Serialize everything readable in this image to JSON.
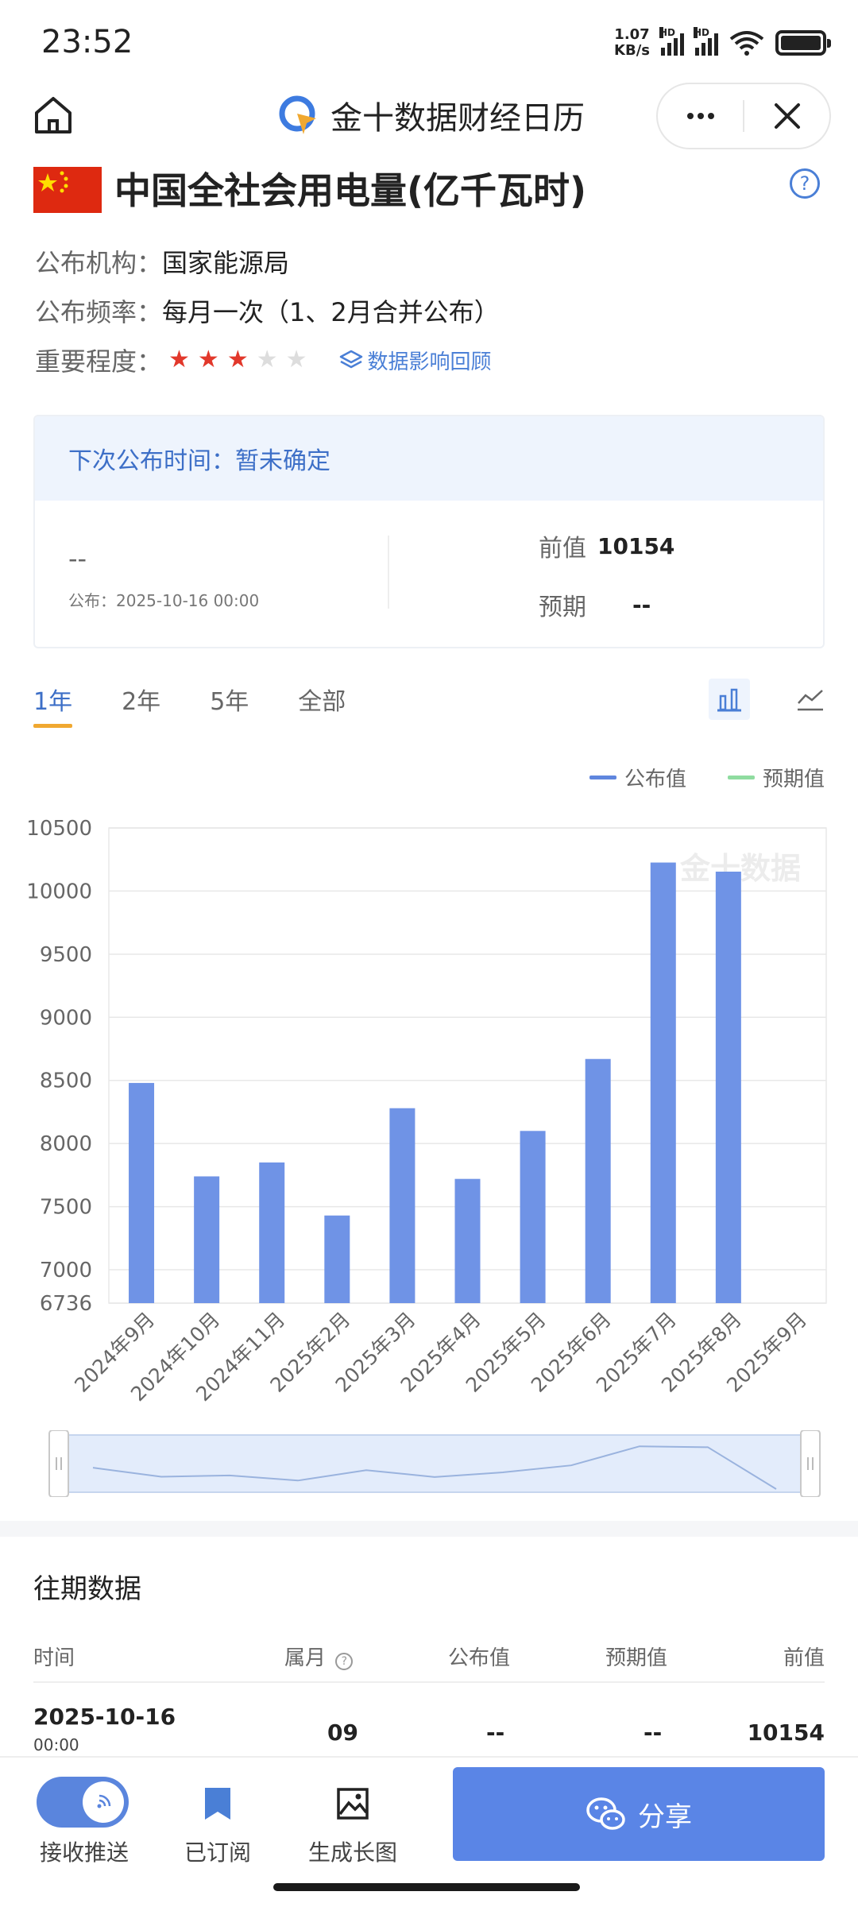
{
  "status_bar": {
    "time": "23:52",
    "net_speed_value": "1.07",
    "net_speed_unit": "KB/s",
    "hd": "HD"
  },
  "header": {
    "app_title": "金十数据财经日历"
  },
  "indicator": {
    "title": "中国全社会用电量(亿千瓦时)",
    "publisher_label": "公布机构：",
    "publisher": "国家能源局",
    "frequency_label": "公布频率：",
    "frequency": "每月一次（1、2月合并公布）",
    "importance_label": "重要程度：",
    "importance": 3,
    "importance_max": 5,
    "impact_link": "数据影响回顾"
  },
  "release": {
    "next_label": "下次公布时间：暂未确定",
    "actual": "--",
    "published": "公布：2025-10-16 00:00",
    "previous_label": "前值",
    "previous": "10154",
    "forecast_label": "预期",
    "forecast": "--"
  },
  "range_tabs": [
    "1年",
    "2年",
    "5年",
    "全部"
  ],
  "legend": {
    "actual": "公布值",
    "forecast": "预期值"
  },
  "watermark": "金十数据",
  "chart_data": {
    "type": "bar",
    "categories": [
      "2024年9月",
      "2024年10月",
      "2024年11月",
      "2025年2月",
      "2025年3月",
      "2025年4月",
      "2025年5月",
      "2025年6月",
      "2025年7月",
      "2025年8月",
      "2025年9月"
    ],
    "series": [
      {
        "name": "公布值",
        "values": [
          8480,
          7740,
          7850,
          7430,
          8280,
          7720,
          8100,
          8670,
          10226,
          10154,
          null
        ]
      },
      {
        "name": "预期值",
        "values": [
          null,
          null,
          null,
          null,
          null,
          null,
          null,
          null,
          null,
          null,
          null
        ]
      }
    ],
    "y_ticks": [
      6736,
      7000,
      7500,
      8000,
      8500,
      9000,
      9500,
      10000,
      10500
    ],
    "ylim": [
      6736,
      10500
    ],
    "grid": true,
    "legend_position": "top-right",
    "colors": {
      "actual": "#6f93e6",
      "forecast": "#8fdca0"
    }
  },
  "history": {
    "title": "往期数据",
    "headers": [
      "时间",
      "属月",
      "公布值",
      "预期值",
      "前值"
    ],
    "rows": [
      {
        "date": "2025-10-16",
        "time": "00:00",
        "month": "09",
        "actual": "--",
        "forecast": "--",
        "previous": "10154"
      }
    ]
  },
  "bottom_bar": {
    "push_label": "接收推送",
    "subscribed_label": "已订阅",
    "longimg_label": "生成长图",
    "share_label": "分享"
  }
}
